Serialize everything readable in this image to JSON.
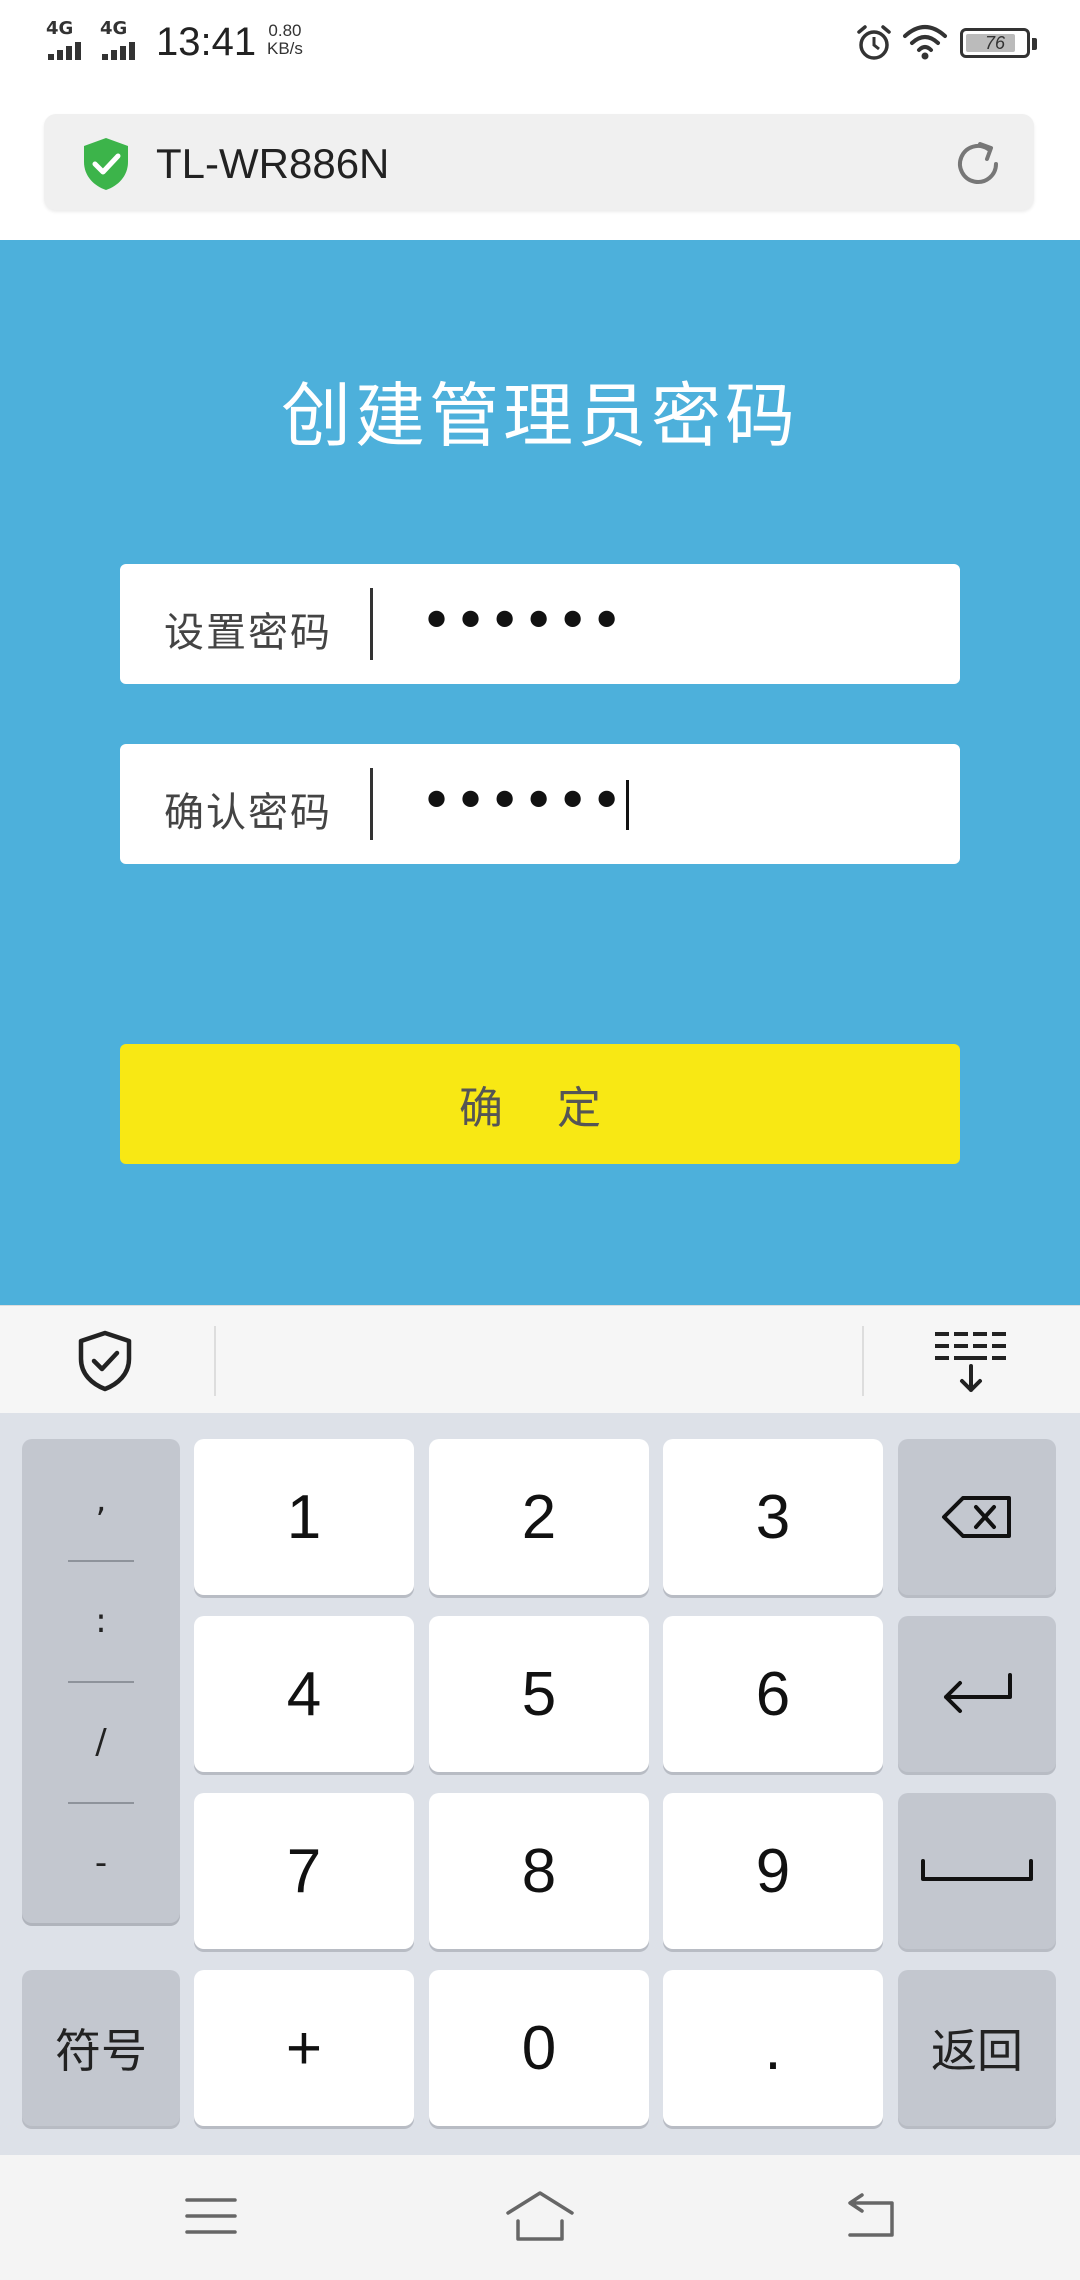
{
  "status_bar": {
    "network_1": "4G",
    "network_2": "4G",
    "time": "13:41",
    "speed_value": "0.80",
    "speed_unit": "KB/s",
    "battery": "76",
    "icons": [
      "alarm-icon",
      "wifi-icon",
      "battery-icon"
    ]
  },
  "browser": {
    "url": "TL-WR886N",
    "secure_icon": "shield-check-icon",
    "reload_icon": "reload-icon"
  },
  "form": {
    "title": "创建管理员密码",
    "set_password_label": "设置密码",
    "set_password_value": "••••••",
    "confirm_password_label": "确认密码",
    "confirm_password_value": "••••••",
    "submit_label": "确 定"
  },
  "keyboard": {
    "toolbar_icons": [
      "shield-icon",
      "keyboard-collapse-icon"
    ],
    "punctuation": [
      ",",
      ":",
      "/",
      "-"
    ],
    "keys": [
      "1",
      "2",
      "3",
      "4",
      "5",
      "6",
      "7",
      "8",
      "9",
      "+",
      "0",
      "."
    ],
    "symbols_label": "符号",
    "return_label": "返回",
    "function_icons": [
      "backspace-icon",
      "enter-icon",
      "space-icon"
    ]
  },
  "nav_bar": {
    "icons": [
      "menu-icon",
      "home-icon",
      "back-icon"
    ]
  },
  "colors": {
    "background": "#4db0db",
    "button": "#f8e814",
    "secure": "#3cb44a",
    "keyboard": "#dde1e8"
  }
}
